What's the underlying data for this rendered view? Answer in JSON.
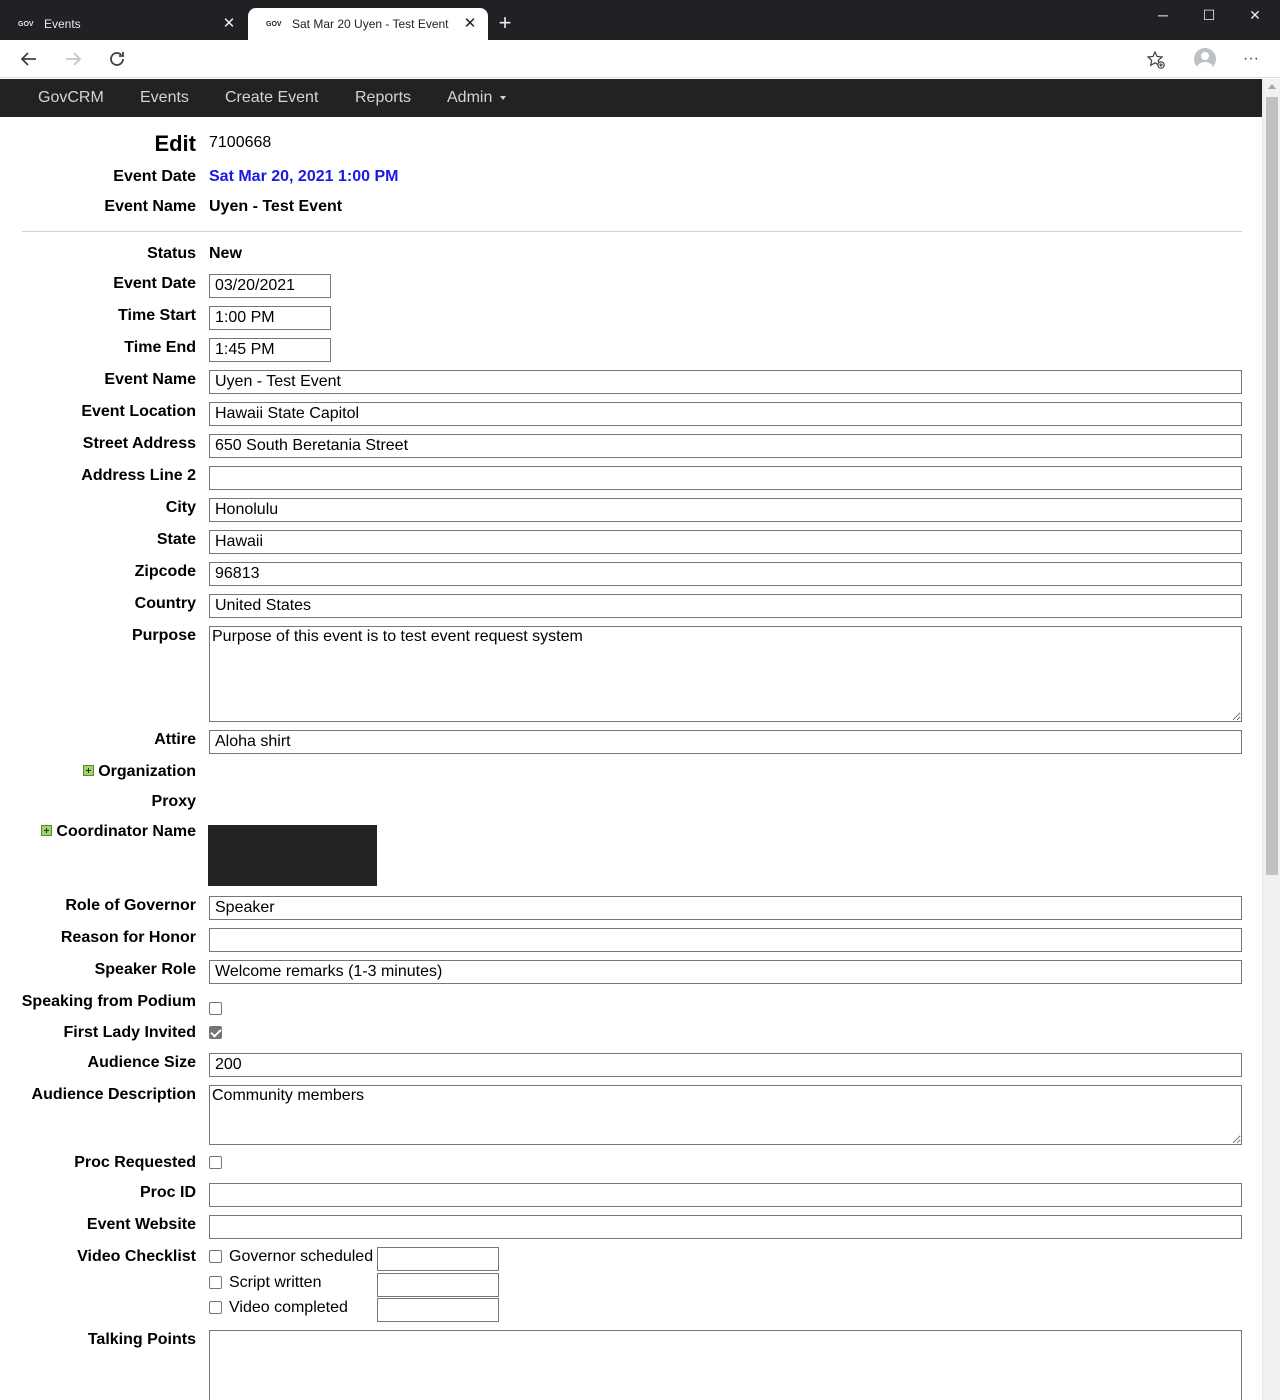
{
  "browser": {
    "tabs": [
      {
        "favicon": "GOV",
        "title": "Events"
      },
      {
        "favicon": "GOV",
        "title": "Sat Mar 20 Uyen - Test Event"
      }
    ],
    "address": "",
    "window_controls": {
      "minimize": "─",
      "maximize": "☐",
      "close": "✕"
    }
  },
  "navbar": {
    "brand": "GovCRM",
    "items": [
      "Events",
      "Create Event",
      "Reports",
      "Admin"
    ]
  },
  "header": {
    "edit_label": "Edit",
    "edit_id": "7100668",
    "event_date_label": "Event Date",
    "event_date_value": "Sat Mar 20, 2021 1:00 PM",
    "event_name_label": "Event Name",
    "event_name_value": "Uyen - Test Event"
  },
  "form": {
    "status_label": "Status",
    "status_value": "New",
    "event_date_label": "Event Date",
    "event_date": "03/20/2021",
    "time_start_label": "Time Start",
    "time_start": "1:00 PM",
    "time_end_label": "Time End",
    "time_end": "1:45 PM",
    "event_name_label": "Event Name",
    "event_name": "Uyen - Test Event",
    "event_location_label": "Event Location",
    "event_location": "Hawaii State Capitol",
    "street_address_label": "Street Address",
    "street_address": "650 South Beretania Street",
    "address_line2_label": "Address Line 2",
    "address_line2": "",
    "city_label": "City",
    "city": "Honolulu",
    "state_label": "State",
    "state": "Hawaii",
    "zipcode_label": "Zipcode",
    "zipcode": "96813",
    "country_label": "Country",
    "country": "United States",
    "purpose_label": "Purpose",
    "purpose": "Purpose of this event is to test event request system",
    "attire_label": "Attire",
    "attire": "Aloha shirt",
    "organization_label": "Organization",
    "proxy_label": "Proxy",
    "coordinator_label": "Coordinator Name",
    "role_governor_label": "Role of Governor",
    "role_governor": "Speaker",
    "reason_honor_label": "Reason for Honor",
    "reason_honor": "",
    "speaker_role_label": "Speaker Role",
    "speaker_role": "Welcome remarks (1-3 minutes)",
    "speaking_podium_label": "Speaking from Podium",
    "speaking_podium": false,
    "first_lady_label": "First Lady Invited",
    "first_lady": true,
    "audience_size_label": "Audience Size",
    "audience_size": "200",
    "audience_desc_label": "Audience Description",
    "audience_desc": "Community members",
    "proc_requested_label": "Proc Requested",
    "proc_requested": false,
    "proc_id_label": "Proc ID",
    "proc_id": "",
    "event_website_label": "Event Website",
    "event_website": "",
    "video_checklist_label": "Video Checklist",
    "video_checklist": [
      {
        "label": "Governor scheduled",
        "checked": false,
        "value": ""
      },
      {
        "label": "Script written",
        "checked": false,
        "value": ""
      },
      {
        "label": "Video completed",
        "checked": false,
        "value": ""
      }
    ],
    "talking_points_label": "Talking Points",
    "talking_points": ""
  },
  "colors": {
    "event_date_link": "#1a1ae0",
    "navbar_bg": "#222222",
    "redaction": "#222222"
  }
}
